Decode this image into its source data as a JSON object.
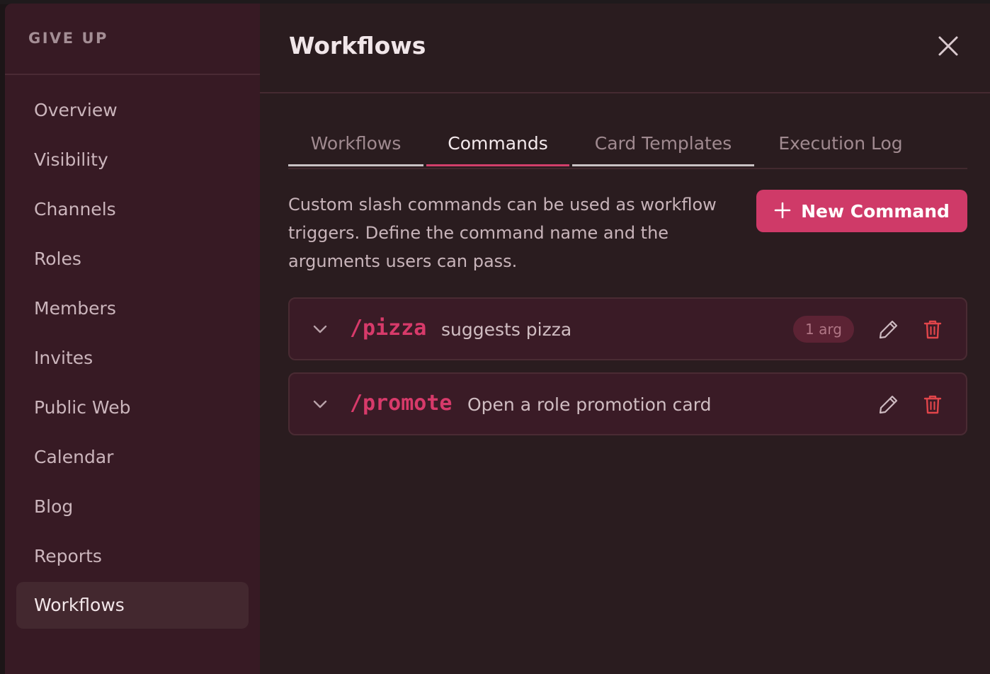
{
  "sidebar": {
    "server_name": "GIVE UP",
    "items": [
      {
        "label": "Overview"
      },
      {
        "label": "Visibility"
      },
      {
        "label": "Channels"
      },
      {
        "label": "Roles"
      },
      {
        "label": "Members"
      },
      {
        "label": "Invites"
      },
      {
        "label": "Public Web"
      },
      {
        "label": "Calendar"
      },
      {
        "label": "Blog"
      },
      {
        "label": "Reports"
      },
      {
        "label": "Workflows",
        "active": true
      }
    ]
  },
  "main": {
    "title": "Workflows",
    "close_icon": "close-icon",
    "tabs": [
      {
        "label": "Workflows"
      },
      {
        "label": "Commands",
        "active": true
      },
      {
        "label": "Card Templates"
      },
      {
        "label": "Execution Log"
      }
    ],
    "description": "Custom slash commands can be used as workflow triggers. Define the command name and the arguments users can pass.",
    "new_button_label": "New Command",
    "commands": [
      {
        "name": "/pizza",
        "description": "suggests pizza",
        "badge": "1 arg"
      },
      {
        "name": "/promote",
        "description": "Open a role promotion card",
        "badge": ""
      }
    ]
  },
  "colors": {
    "accent": "#cf3a68",
    "command_name": "#d73a6a",
    "delete_icon": "#e0454a",
    "sidebar_bg": "#371a24",
    "main_bg": "#2a1c1f"
  }
}
